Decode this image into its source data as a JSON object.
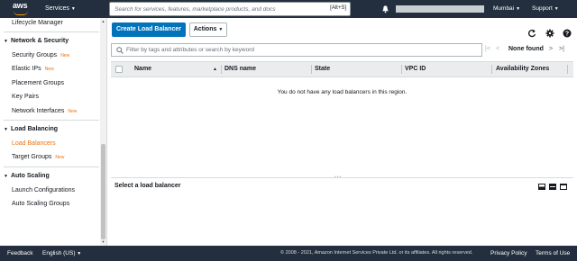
{
  "topnav": {
    "logo_text": "aws",
    "services_label": "Services",
    "search_placeholder": "Search for services, features, marketplace products, and docs",
    "search_shortcut": "[Alt+S]",
    "region_label": "Mumbai",
    "support_label": "Support"
  },
  "sidebar": {
    "top_item": "Lifecycle Manager",
    "groups": [
      {
        "title": "Network & Security",
        "items": [
          {
            "label": "Security Groups",
            "badge": "New"
          },
          {
            "label": "Elastic IPs",
            "badge": "New"
          },
          {
            "label": "Placement Groups",
            "badge": ""
          },
          {
            "label": "Key Pairs",
            "badge": ""
          },
          {
            "label": "Network Interfaces",
            "badge": "New"
          }
        ]
      },
      {
        "title": "Load Balancing",
        "items": [
          {
            "label": "Load Balancers",
            "badge": "",
            "active": true
          },
          {
            "label": "Target Groups",
            "badge": "New"
          }
        ]
      },
      {
        "title": "Auto Scaling",
        "items": [
          {
            "label": "Launch Configurations",
            "badge": ""
          },
          {
            "label": "Auto Scaling Groups",
            "badge": ""
          }
        ]
      }
    ]
  },
  "main": {
    "create_button": "Create Load Balancer",
    "actions_button": "Actions",
    "filter_placeholder": "Filter by tags and attributes or search by keyword",
    "pagination_status": "None found",
    "columns": [
      "Name",
      "DNS name",
      "State",
      "VPC ID",
      "Availability Zones"
    ],
    "empty_message": "You do not have any load balancers in this region.",
    "detail_title": "Select a load balancer"
  },
  "footer": {
    "feedback": "Feedback",
    "language": "English (US)",
    "copyright": "© 2008 - 2021, Amazon Internet Services Private Ltd. or its affiliates. All rights reserved.",
    "privacy": "Privacy Policy",
    "terms": "Terms of Use"
  },
  "colors": {
    "nav_bg": "#232f3e",
    "primary_button": "#0073bb",
    "accent_orange": "#ec7211",
    "logo_smile": "#ff9900"
  },
  "icons": [
    "bell-icon",
    "refresh-icon",
    "settings-icon",
    "help-icon",
    "search-icon",
    "layout-icon"
  ]
}
